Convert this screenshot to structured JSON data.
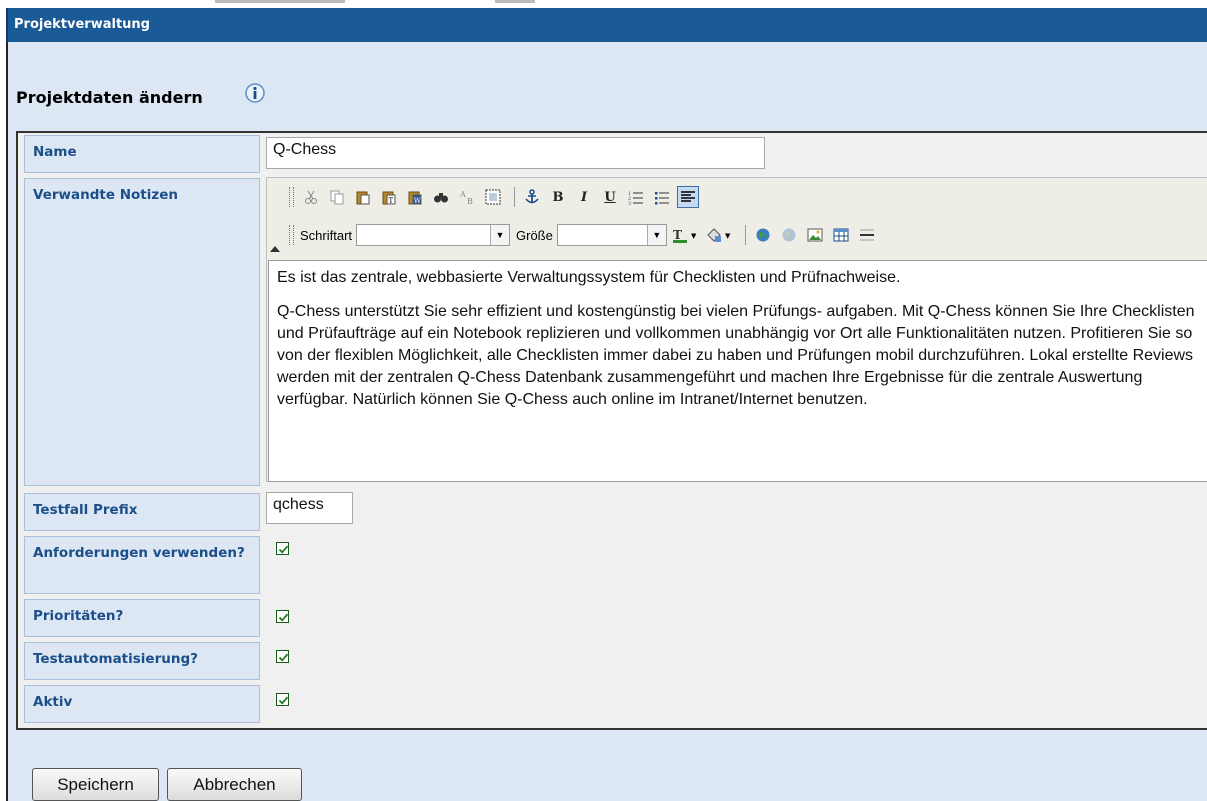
{
  "window": {
    "title": "Projektverwaltung"
  },
  "form": {
    "heading": "Projektdaten ändern",
    "fields": {
      "name": {
        "label": "Name",
        "value": "Q-Chess"
      },
      "notes": {
        "label": "Verwandte Notizen"
      },
      "prefix": {
        "label": "Testfall Prefix",
        "value": "qchess"
      },
      "requirements": {
        "label": "Anforderungen verwenden?",
        "checked": true
      },
      "priorities": {
        "label": "Prioritäten?",
        "checked": true
      },
      "automation": {
        "label": "Testautomatisierung?",
        "checked": true
      },
      "active": {
        "label": "Aktiv",
        "checked": true
      }
    }
  },
  "editor": {
    "font_label": "Schriftart",
    "font_value": "",
    "size_label": "Größe",
    "size_value": "",
    "toolbar_row1": [
      "cut-icon",
      "copy-icon",
      "paste-icon",
      "paste-text-icon",
      "paste-word-icon",
      "find-icon",
      "replace-icon",
      "select-all-icon",
      "anchor-icon",
      "bold-icon",
      "italic-icon",
      "underline-icon",
      "ordered-list-icon",
      "unordered-list-icon",
      "align-left-icon"
    ],
    "toolbar_row2": [
      "text-color-icon",
      "background-color-icon",
      "link-icon",
      "unlink-icon",
      "image-icon",
      "table-icon",
      "horizontal-rule-icon"
    ],
    "bold_glyph": "B",
    "italic_glyph": "I",
    "underline_glyph": "U",
    "paragraphs": [
      "Es ist das zentrale, webbasierte Verwaltungssystem für Checklisten und Prüfnachweise.",
      "Q-Chess unterstützt Sie sehr effizient und kostengünstig bei vielen Prüfungs- aufgaben. Mit Q-Chess können Sie Ihre Checklisten und Prüfaufträge auf ein Notebook replizieren und vollkommen unabhängig vor Ort alle Funktionalitäten nutzen. Profitieren Sie so von der flexiblen Möglichkeit, alle Checklisten immer dabei zu haben und Prüfungen mobil durchzuführen. Lokal erstellte Reviews werden mit der zentralen Q-Chess Datenbank zusammengeführt und machen Ihre Ergebnisse für die zentrale Auswertung verfügbar. Natürlich können Sie Q-Chess auch online im Intranet/Internet benutzen."
    ]
  },
  "buttons": {
    "save": "Speichern",
    "cancel": "Abbrechen"
  },
  "colors": {
    "titlebar": "#1a5a96",
    "label_text": "#1c4f8a",
    "panel": "#dce7f3"
  }
}
